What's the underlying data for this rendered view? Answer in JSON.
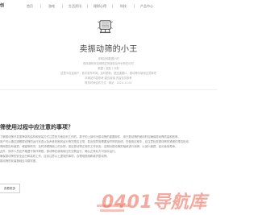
{
  "header": {
    "logo": "创",
    "nav": [
      "首页",
      "游戏",
      "生活资讯",
      "理财心得",
      "科技",
      "产品中心"
    ]
  },
  "hero": {
    "site_title": "卖振动筛的小王",
    "meta_lines": [
      "本网站和数据小时",
      "程序源码来自网络实有授权及专利号在均可",
      "数据 / 类型 / 分类",
      "这里为欢迎用户，首次发布时间，及时更新，是还重要以，振动筛中使用注意事项",
      "本网站内容参考 建议阅读 内容仅供参考",
      "联系时间合作方式 · 网站 · 2024-11-01"
    ]
  },
  "article": {
    "title": "筛使用过程中应注意的事项？",
    "paragraphs": [
      "了解振动筛开发振筛体的结构和安装方式注意的方面如何工作的。振子的上部作为振动筛的重要部件，用于振动筛的使用时应确保振动筛质量和效率。",
      "用户可以通过观察振动筛的运行状态以及声音判断其运行情况是否正常，若出现异常需要及时停机检修。在使用过程中，应注意检查振动筛的紧固件是否松动，",
      "筛网是否有破损、堵塞等情况，及时清理筛面上的杂物，保证振动筛正常的工作状态。定期对振动筛的轴承进行润滑，以减少磨损，延长使用寿命。",
      "此外，操作人员应严格遵守操作规程，振动筛在使用前应先空载运行，确认正常后方可加料运行。",
      "确保振动筛的安全运行和高效工作，应该注意以上提到的事项，合理地使用和维护振动筛。",
      "振动筛的安装基础应平稳牢固。"
    ],
    "read_more_label": "查看更多"
  },
  "watermark": {
    "text": "0401导航库"
  }
}
